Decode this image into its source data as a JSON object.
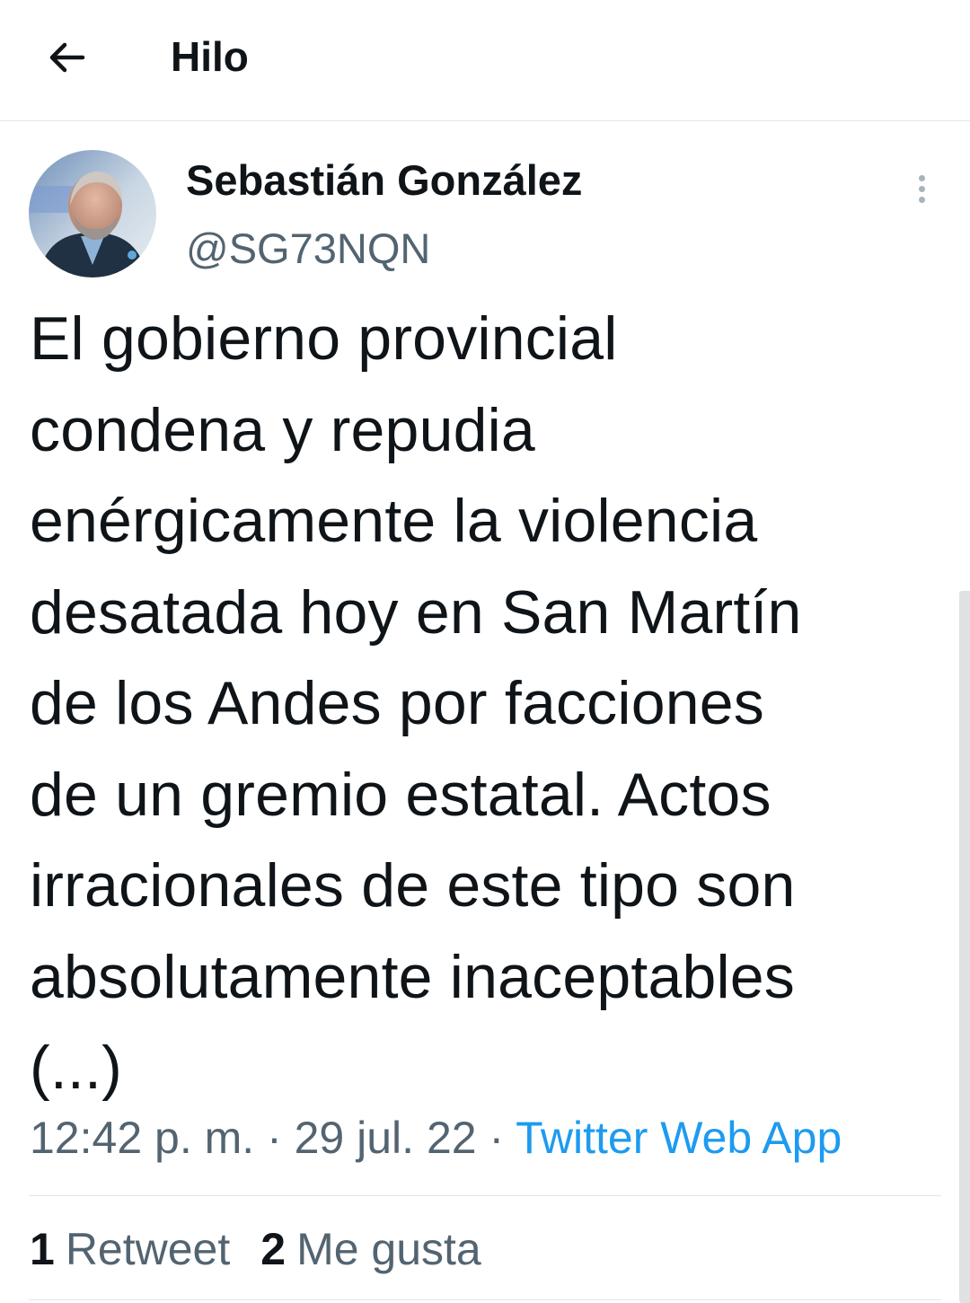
{
  "header": {
    "back_icon": "arrow-left-icon",
    "title": "Hilo"
  },
  "tweet": {
    "author": {
      "display_name": "Sebastián González",
      "handle": "@SG73NQN",
      "avatar": "profile-photo"
    },
    "more_icon": "vertical-ellipsis-icon",
    "text": "El gobierno provincial\ncondena y repudia\nenérgicamente la violencia\ndesatada hoy en San Martín\nde los Andes por facciones\nde un gremio estatal. Actos\nirracionales de este tipo son\nabsolutamente inaceptables\n(...)",
    "time": "12:42 p. m.",
    "separator": "·",
    "date": "29 jul. 22",
    "source": "Twitter Web App",
    "stats": {
      "retweets_count": "1",
      "retweets_label": "Retweet",
      "likes_count": "2",
      "likes_label": "Me gusta"
    }
  },
  "colors": {
    "text_primary": "#0f1419",
    "text_secondary": "#536471",
    "link": "#1d9bf0",
    "divider": "#e3e6e8"
  }
}
